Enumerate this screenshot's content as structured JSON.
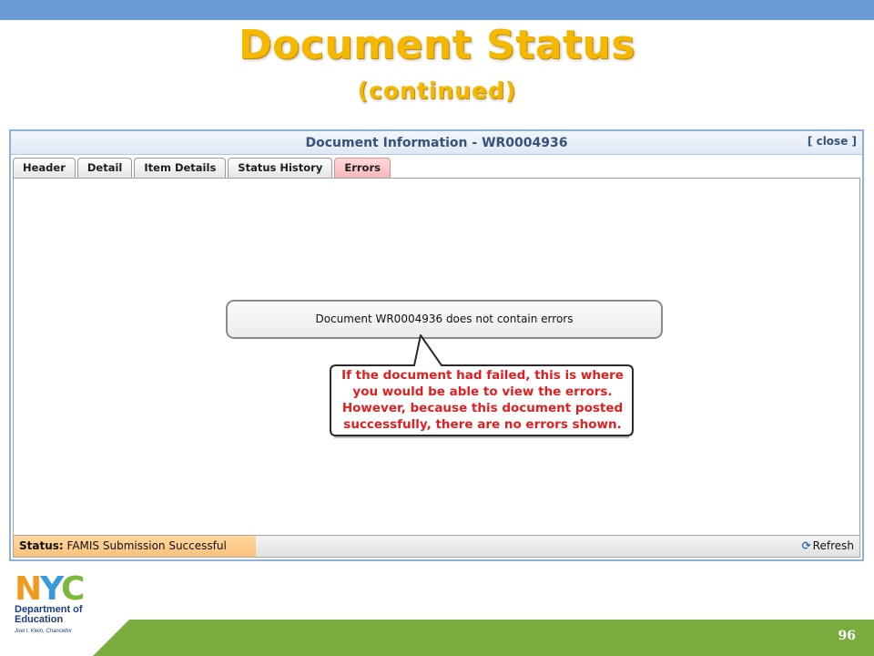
{
  "slide": {
    "title": "Document Status",
    "subtitle": "(continued)",
    "page_number": "96"
  },
  "window": {
    "title": "Document Information - WR0004936",
    "close_label": "[ close ]"
  },
  "tabs": [
    {
      "label": "Header",
      "active": false
    },
    {
      "label": "Detail",
      "active": false
    },
    {
      "label": "Item Details",
      "active": false
    },
    {
      "label": "Status History",
      "active": false
    },
    {
      "label": "Errors",
      "active": true
    }
  ],
  "message": "Document WR0004936 does not contain errors",
  "callout": {
    "lines": [
      "If the document had failed, this is where",
      "you would be able to view the errors.",
      "However, because this document posted",
      "successfully, there are no errors shown."
    ]
  },
  "status_bar": {
    "label": "Status:",
    "value": "FAMIS Submission Successful",
    "refresh_label": "Refresh"
  },
  "logo": {
    "nyc_n": "N",
    "nyc_y": "Y",
    "nyc_c": "C",
    "dept_line1": "Department of",
    "dept_line2": "Education",
    "chancellor": "Joel I. Klein, Chancellor"
  },
  "colors": {
    "title": "#f5b800",
    "top_bar": "#6b9bd2",
    "footer_green": "#7aab3e",
    "callout_text": "#e02020",
    "active_tab": "#f6b6ba",
    "status_highlight": "#f9c27a"
  }
}
